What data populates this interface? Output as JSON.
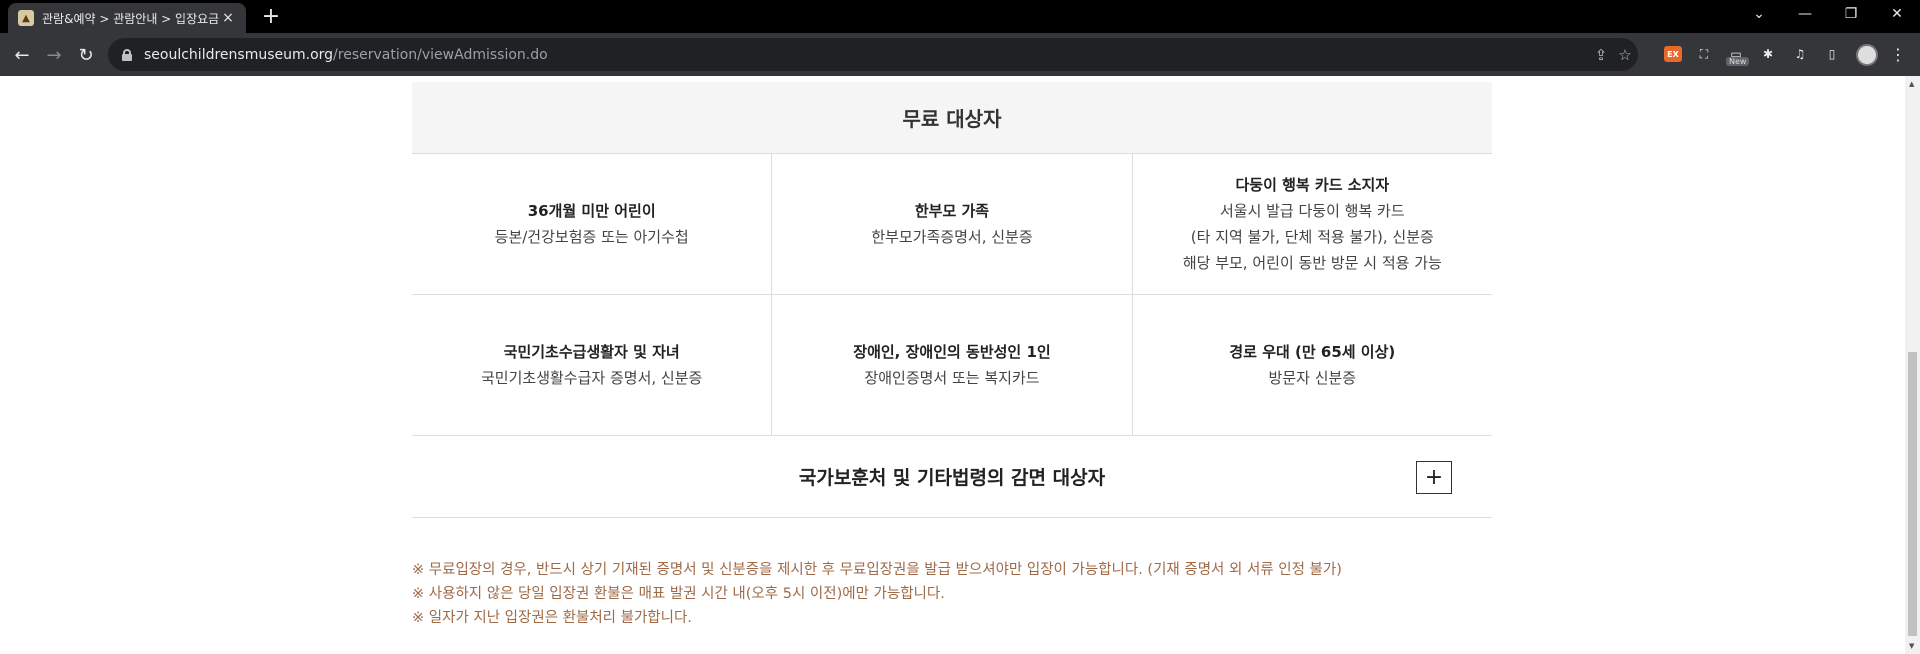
{
  "browser": {
    "tab": {
      "title": "관람&예약 > 관람안내 > 입장요금",
      "close": "×",
      "new_tab": "+"
    },
    "window_controls": {
      "tablist": "⌄",
      "minimize": "—",
      "restore": "❐",
      "close": "✕"
    },
    "nav": {
      "back": "←",
      "forward": "→",
      "reload": "↻"
    },
    "url": {
      "host": "seoulchildrensmuseum.org",
      "path": "/reservation/viewAdmission.do"
    },
    "omnibox_icons": {
      "share": "⇪",
      "bookmark": "☆"
    },
    "extensions": {
      "ext1_label": "EX",
      "ext2": "⛶",
      "ext3": "▭",
      "ext3_badge": "New",
      "puzzle": "✱",
      "media": "♫",
      "sidepanel": "▯",
      "menu": "⋮"
    }
  },
  "free": {
    "heading": "무료 대상자",
    "rows": [
      [
        {
          "title": "36개월 미만 어린이",
          "lines": [
            "등본/건강보험증 또는 아기수첩"
          ]
        },
        {
          "title": "한부모 가족",
          "lines": [
            "한부모가족증명서, 신분증"
          ]
        },
        {
          "title": "다둥이 행복 카드 소지자",
          "lines": [
            "서울시 발급 다둥이 행복 카드",
            "(타 지역 불가, 단체 적용 불가), 신분증",
            "해당 부모, 어린이 동반 방문 시 적용 가능"
          ]
        }
      ],
      [
        {
          "title": "국민기초수급생활자 및 자녀",
          "lines": [
            "국민기초생활수급자 증명서, 신분증"
          ]
        },
        {
          "title": "장애인, 장애인의 동반성인 1인",
          "lines": [
            "장애인증명서 또는 복지카드"
          ]
        },
        {
          "title": "경로 우대 (만 65세 이상)",
          "lines": [
            "방문자 신분증"
          ]
        }
      ]
    ]
  },
  "accordion": {
    "title": "국가보훈처 및 기타법령의 감면 대상자",
    "toggle": "+"
  },
  "notes": [
    "※ 무료입장의 경우, 반드시 상기 기재된 증명서 및 신분증을 제시한 후 무료입장권을 발급 받으셔야만 입장이 가능합니다. (기재 증명서 외 서류 인정 불가)",
    "※ 사용하지 않은 당일 입장권 환불은 매표 발권 시간 내(오후 5시 이전)에만 가능합니다.",
    "※ 일자가 지난 입장권은 환불처리 불가합니다."
  ],
  "colors": {
    "note": "#a06a48",
    "header_bg": "#f5f5f5",
    "chrome_dark": "#35363a"
  }
}
